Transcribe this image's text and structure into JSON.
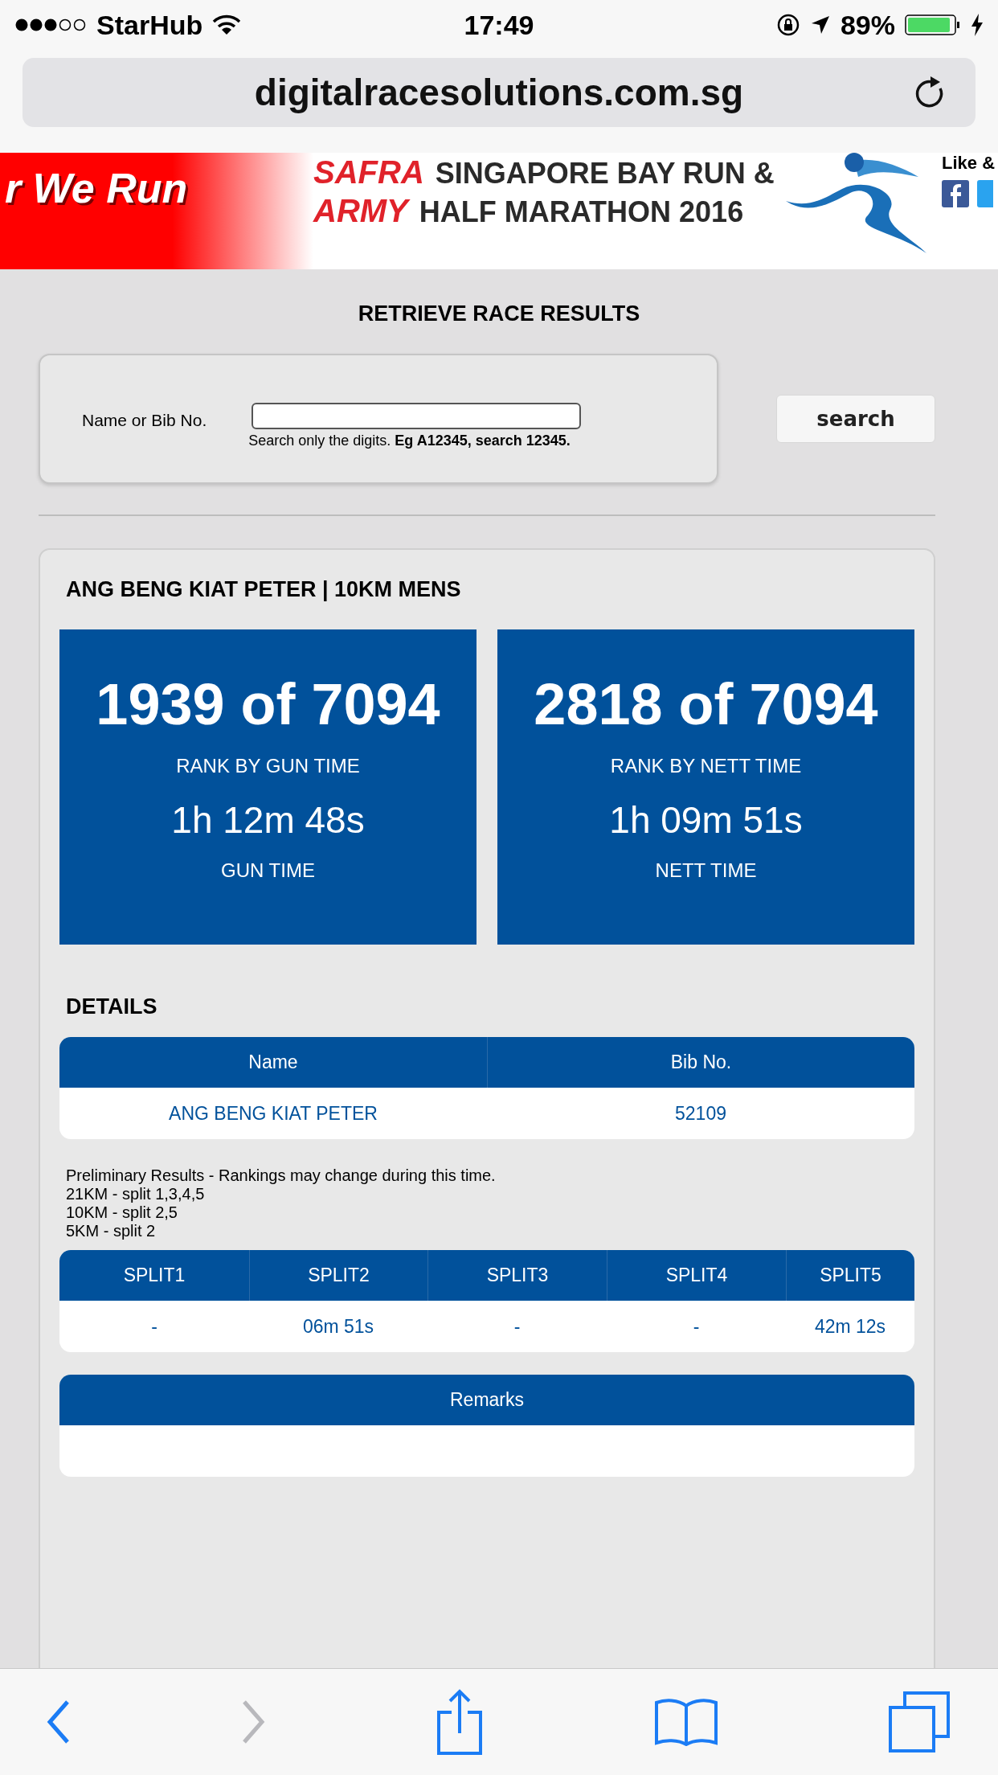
{
  "status_bar": {
    "carrier": "StarHub",
    "time": "17:49",
    "battery": "89%"
  },
  "address_bar": {
    "url": "digitalracesolutions.com.sg"
  },
  "banner": {
    "slogan": "r We Run",
    "brand_top": "SAFRA",
    "event_top": "SINGAPORE BAY RUN &",
    "brand_bottom": "ARMY",
    "event_bottom": "HALF MARATHON 2016",
    "social": "Like &"
  },
  "page_title": "RETRIEVE RACE RESULTS",
  "search": {
    "label": "Name or Bib No.",
    "hint": "Search only the digits. **Eg A12345, search 12345.**",
    "button": "search"
  },
  "result": {
    "title": "ANG BENG KIAT PETER | 10KM MENS",
    "stats": [
      {
        "rank": "1939 of 7094",
        "rank_label": "RANK BY GUN TIME",
        "time": "1h 12m 48s",
        "time_label": "GUN TIME"
      },
      {
        "rank": "2818 of 7094",
        "rank_label": "RANK BY NETT TIME",
        "time": "1h 09m 51s",
        "time_label": "NETT TIME"
      }
    ],
    "details_heading": "DETAILS",
    "details_table": {
      "columns": [
        "Name",
        "Bib No."
      ],
      "rows": [
        [
          "ANG BENG KIAT PETER",
          "52109"
        ]
      ]
    },
    "notes": [
      "Preliminary Results - Rankings may change during this time.",
      "21KM - split 1,3,4,5",
      "10KM - split 2,5",
      "5KM - split 2"
    ],
    "splits_table": {
      "columns": [
        "SPLIT1",
        "SPLIT2",
        "SPLIT3",
        "SPLIT4",
        "SPLIT5"
      ],
      "rows": [
        [
          "-",
          "06m 51s",
          "-",
          "-",
          "42m 12s"
        ]
      ]
    },
    "remarks_table": {
      "columns": [
        "Remarks"
      ]
    }
  },
  "toolbar": [
    {
      "kind": "back",
      "disabled": false
    },
    {
      "kind": "forward",
      "disabled": true
    },
    {
      "kind": "share",
      "disabled": false
    },
    {
      "kind": "bookmarks",
      "disabled": false
    },
    {
      "kind": "tabs",
      "disabled": false
    }
  ]
}
